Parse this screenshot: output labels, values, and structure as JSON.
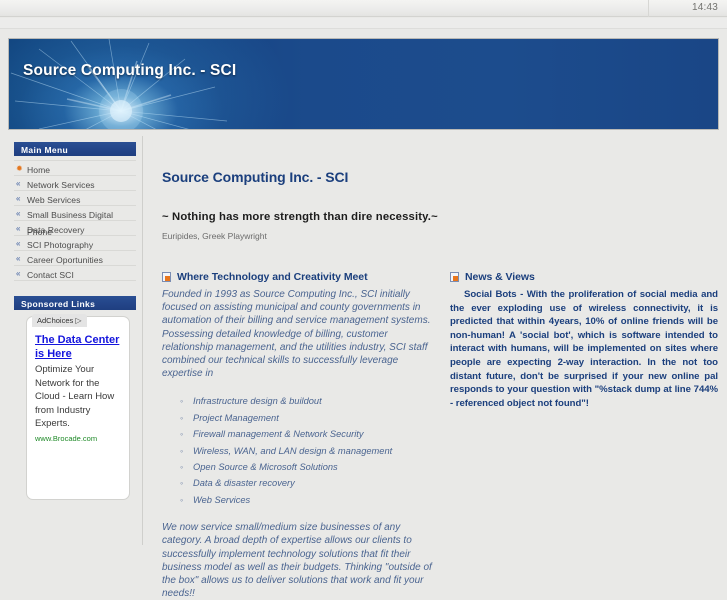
{
  "chrome": {
    "clock": "14:43"
  },
  "banner": {
    "title": "Source Computing Inc. - SCI"
  },
  "sidebar": {
    "menu": {
      "heading": "Main Menu",
      "items": [
        {
          "label": "Home",
          "marker": "burst-icon"
        },
        {
          "label": "Network Services",
          "marker": "double-arrow-icon"
        },
        {
          "label": "Web Services",
          "marker": "double-arrow-icon"
        },
        {
          "label": "Small Business Digital Phone",
          "marker": "double-arrow-icon"
        },
        {
          "label": "Data Recovery",
          "marker": "double-arrow-icon"
        },
        {
          "label": "SCI Photography",
          "marker": "double-arrow-icon"
        },
        {
          "label": "Career Oportunities",
          "marker": "double-arrow-icon"
        },
        {
          "label": "Contact SCI",
          "marker": "double-arrow-icon"
        }
      ]
    },
    "sponsored": {
      "heading": "Sponsored Links",
      "ad": {
        "adchoices_label": "AdChoices",
        "adchoices_icon": "triangle-right-icon",
        "headline": "The Data Center is Here",
        "body": "Optimize Your Network for the Cloud - Learn How from Industry Experts.",
        "display_url": "www.Brocade.com"
      }
    }
  },
  "main": {
    "page_title": "Source Computing Inc. - SCI",
    "quote": "~ Nothing has more strength than dire necessity.~",
    "quote_author": "Euripides, Greek Playwright",
    "left_column": {
      "heading": "Where Technology and Creativity Meet",
      "heading_icon": "document-new-icon",
      "paragraph_1": "Founded in 1993 as Source Computing Inc., SCI initially focused on assisting municipal and county governments in automation of their billing and service management systems.  Possessing detailed knowledge of billing, customer relationship management, and the utilities industry, SCI staff combined our technical skills to successfully leverage expertise  in",
      "services": [
        "Infrastructure design & buildout",
        "Project Management",
        "Firewall management & Network Security",
        "Wireless, WAN, and LAN design & management",
        "Open Source & Microsoft Solutions",
        "Data & disaster recovery",
        "Web Services"
      ],
      "paragraph_2": "We now service small/medium size businesses of any category.  A broad depth of expertise allows our clients to successfully implement technology solutions that fit their business model as well as their budgets.  Thinking \"outside of the box\" allows us to deliver solutions that work and fit your needs!!"
    },
    "right_column": {
      "heading": "News & Views",
      "heading_icon": "document-new-icon",
      "article": "Social Bots - With the proliferation of social media and the ever exploding use of wireless connectivity, it is predicted that within 4years, 10% of online friends will be non-human!  A 'social bot', which is software intended to interact with humans, will be implemented on sites where people are expecting 2-way interaction.  In the not too distant future, don't be surprised if your new online pal responds to your question with \"%stack dump at line 744% - referenced object not found\"!"
    }
  },
  "colors": {
    "banner_blue": "#1b4a8b",
    "heading_blue": "#1b3f7d",
    "block_head_blue": "#24468a",
    "body_blue": "#4a6490",
    "ad_link_blue": "#1414dd",
    "ad_url_green": "#1f8a28",
    "page_bg": "#e9e9e7",
    "home_marker_orange": "#e4771f"
  }
}
